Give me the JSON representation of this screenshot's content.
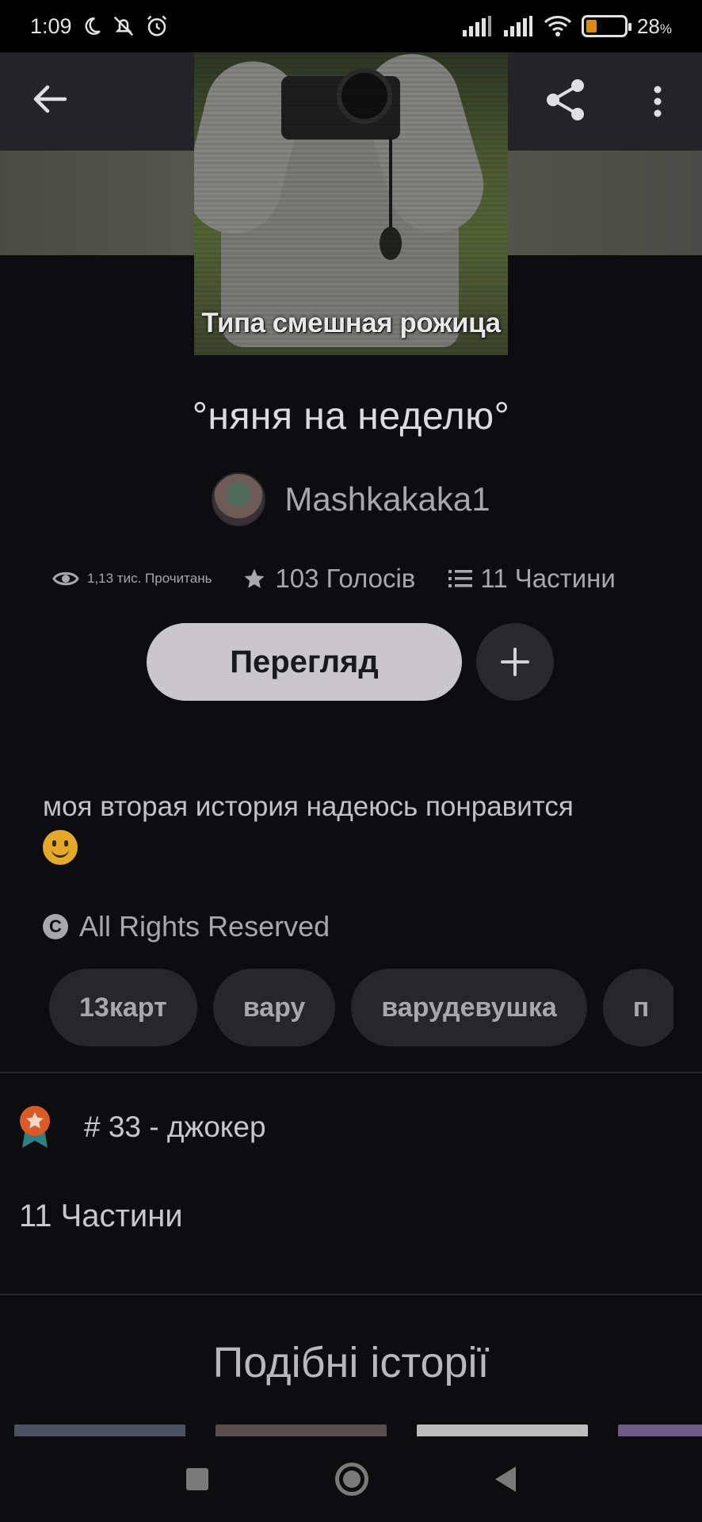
{
  "status_bar": {
    "time": "1:09",
    "battery_percent": "28",
    "battery_unit": "%"
  },
  "cover": {
    "caption": "Типа смешная рожица"
  },
  "story": {
    "title": "°няня на неделю°",
    "author": "Mashkakaka1",
    "reads": "1,13 тис. Прочитань",
    "votes": "103 Голосів",
    "parts": "11 Частини"
  },
  "actions": {
    "read_label": "Перегляд",
    "add_icon": "plus-icon"
  },
  "description": "моя вторая история надеюсь понравится",
  "license": "All Rights Reserved",
  "tags": [
    "13карт",
    "вару",
    "варудевушка",
    "п"
  ],
  "ranking": "# 33 - джокер",
  "parts_heading": "11 Частини",
  "similar": {
    "title": "Подібні історії"
  },
  "colors": {
    "background": "#0d0c0e",
    "primary_button": "#c9c7cc",
    "chip": "#27262a",
    "badge": "#d95b2a"
  }
}
